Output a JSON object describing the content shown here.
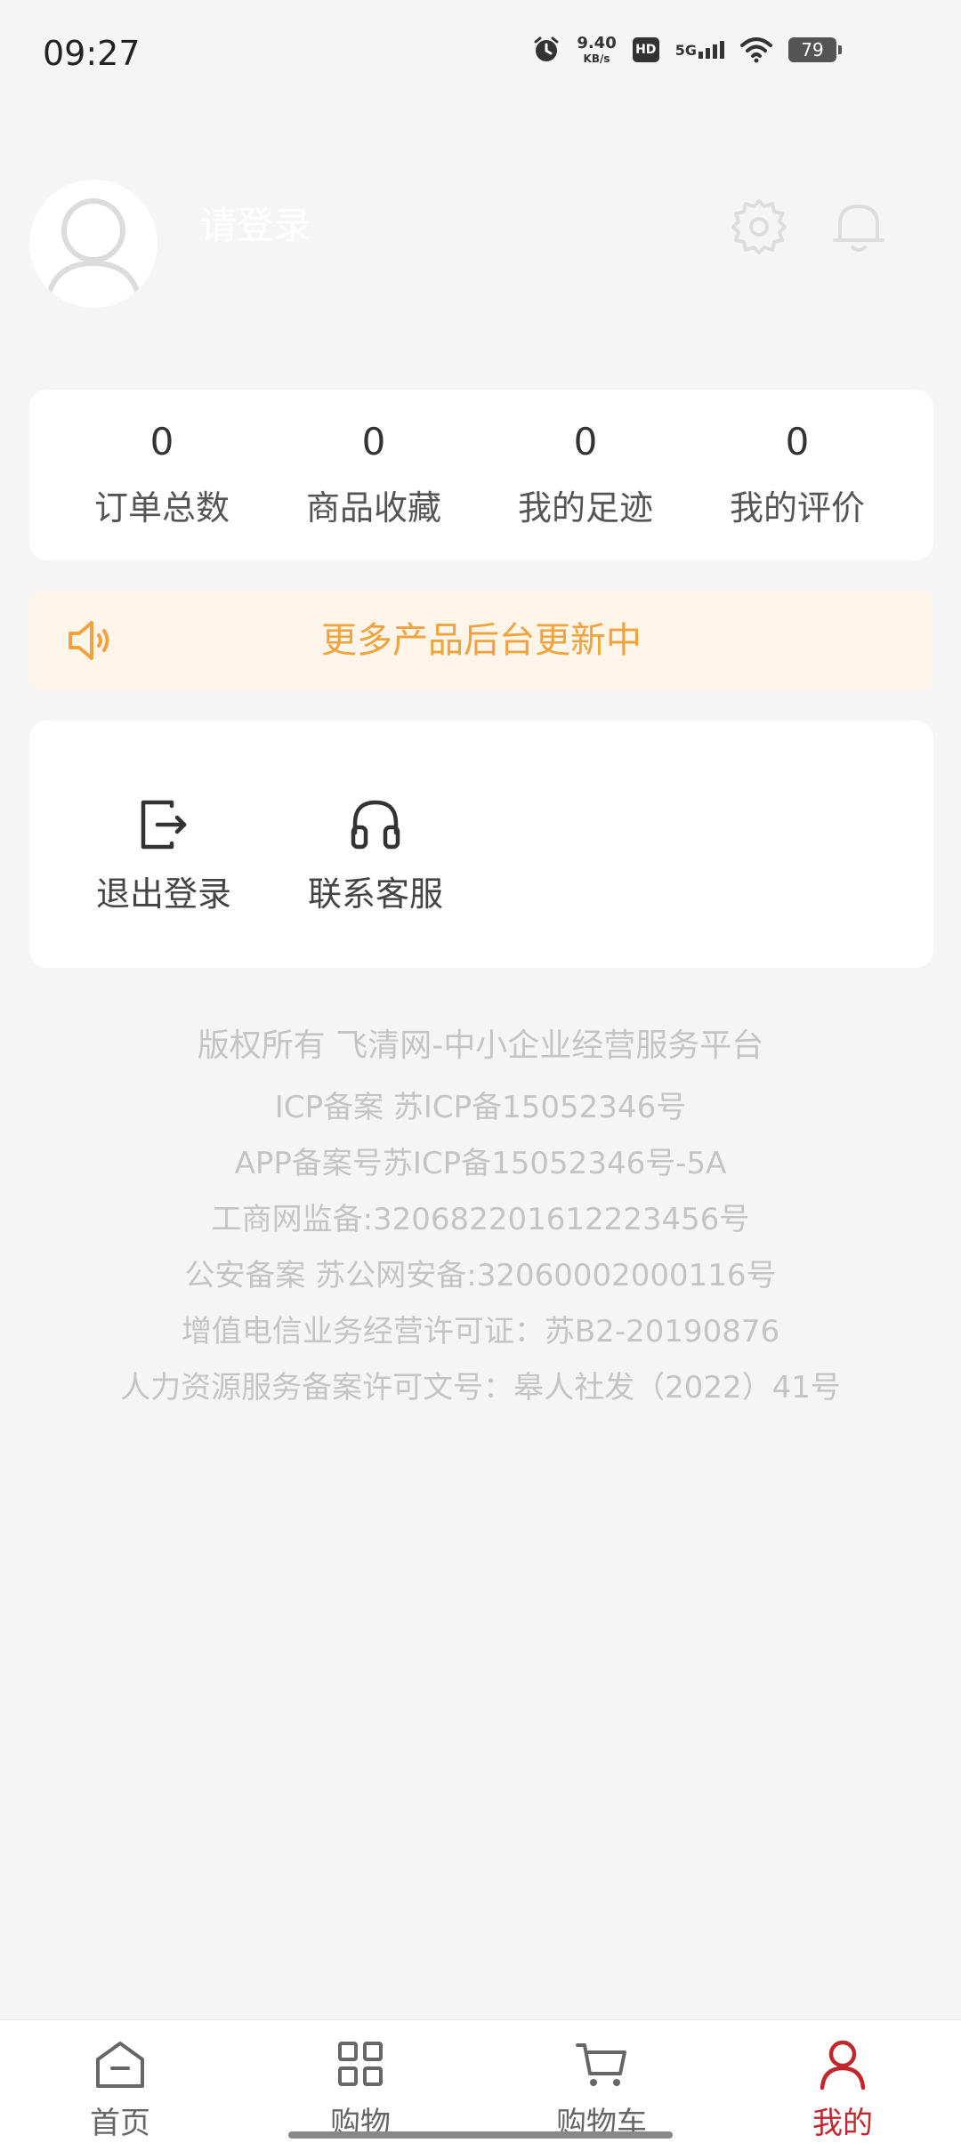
{
  "status_bar": {
    "time": "09:27",
    "net_speed_value": "9.40",
    "net_speed_unit": "KB/s",
    "hd_label": "HD",
    "network_label": "5G",
    "battery": "79"
  },
  "header": {
    "login_prompt": "请登录"
  },
  "stats": [
    {
      "value": "0",
      "label": "订单总数"
    },
    {
      "value": "0",
      "label": "商品收藏"
    },
    {
      "value": "0",
      "label": "我的足迹"
    },
    {
      "value": "0",
      "label": "我的评价"
    }
  ],
  "notice": {
    "text": "更多产品后台更新中"
  },
  "actions": {
    "logout_label": "退出登录",
    "service_label": "联系客服"
  },
  "footer": {
    "lines": [
      "版权所有 飞清网-中小企业经营服务平台",
      "ICP备案 苏ICP备15052346号",
      "APP备案号苏ICP备15052346号-5A",
      "工商网监备:320682201612223456号",
      "公安备案 苏公网安备:32060002000116号",
      "增值电信业务经营许可证：苏B2-20190876",
      "人力资源服务备案许可文号：皋人社发（2022）41号"
    ]
  },
  "bottom_nav": {
    "items": [
      {
        "label": "首页",
        "icon": "home-icon"
      },
      {
        "label": "购物",
        "icon": "grid-icon"
      },
      {
        "label": "购物车",
        "icon": "cart-icon"
      },
      {
        "label": "我的",
        "icon": "user-icon"
      }
    ],
    "active_index": 3
  },
  "colors": {
    "accent": "#c0282d",
    "notice_text": "#f0a33c",
    "notice_bg": "#fdf5ea",
    "page_bg": "#f5f5f5"
  }
}
